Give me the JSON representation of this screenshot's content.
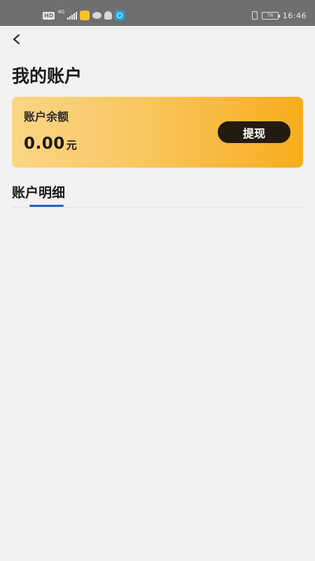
{
  "status_bar": {
    "hd_label": "HD",
    "network_label": "4G",
    "battery_level": "78",
    "time": "16:46",
    "icons": [
      "hd-icon",
      "signal-icon",
      "app-notification-icon",
      "chat-icon",
      "qq-icon",
      "browser-icon",
      "vibrate-icon",
      "battery-icon"
    ]
  },
  "header": {
    "back_icon": "chevron-left-icon",
    "title": "我的账户"
  },
  "balance_card": {
    "label": "账户余额",
    "amount": "0.00",
    "unit": "元",
    "withdraw_label": "提现",
    "colors": {
      "gradient_start": "#fbd685",
      "gradient_end": "#f7ad1c",
      "button": "#231b0f"
    }
  },
  "details": {
    "tab_label": "账户明细",
    "indicator_color": "#2d5fc6"
  }
}
